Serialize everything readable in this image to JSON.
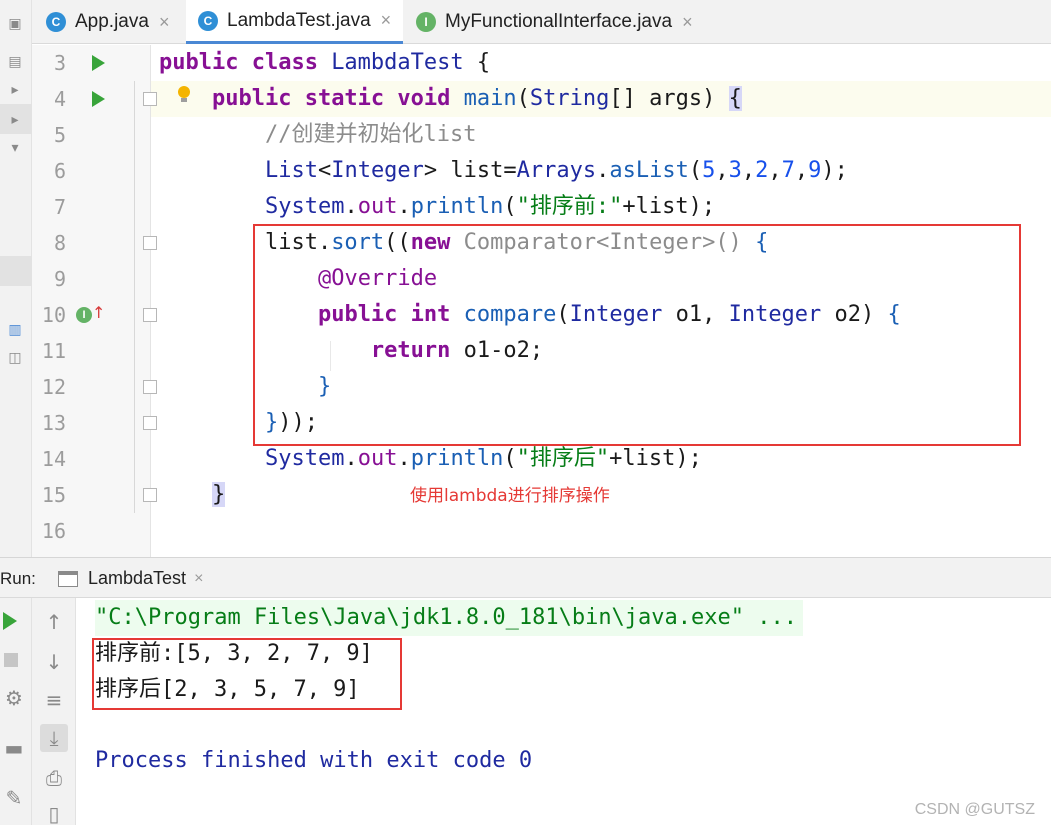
{
  "tabs": [
    {
      "label": "App.java",
      "icon": "class-icon",
      "active": false
    },
    {
      "label": "LambdaTest.java",
      "icon": "class-icon",
      "active": true
    },
    {
      "label": "MyFunctionalInterface.java",
      "icon": "interface-icon",
      "active": false
    }
  ],
  "tab_icon_letters": {
    "class": "C",
    "interface": "I"
  },
  "close_glyph": "×",
  "editor": {
    "line_numbers": [
      "3",
      "4",
      "5",
      "6",
      "7",
      "8",
      "9",
      "10",
      "11",
      "12",
      "13",
      "14",
      "15",
      "16"
    ],
    "annotation": "使用lambda进行排序操作",
    "implements_marker": "I"
  },
  "run": {
    "label": "Run:",
    "tab_label": "LambdaTest",
    "command": "\"C:\\Program Files\\Java\\jdk1.8.0_181\\bin\\java.exe\" ...",
    "output_before": "排序前:[5, 3, 2, 7, 9]",
    "output_after": "排序后[2, 3, 5, 7, 9]",
    "process_line": "Process finished with exit code 0"
  },
  "watermark": "CSDN @GUTSZ",
  "colors": {
    "keyword": "#871094",
    "string": "#067d17",
    "number": "#1750eb",
    "highlight_box": "#e53935",
    "run_green": "#38a43a"
  }
}
